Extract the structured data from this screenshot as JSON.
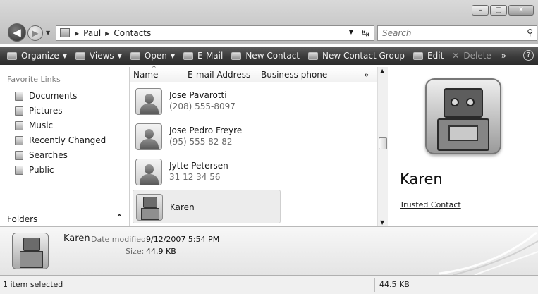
{
  "window": {
    "minimize_glyph": "–",
    "maximize_glyph": "▢",
    "close_glyph": "✕"
  },
  "address": {
    "crumbs": [
      "Paul",
      "Contacts"
    ]
  },
  "search": {
    "placeholder": "Search"
  },
  "toolbar": {
    "organize": "Organize",
    "views": "Views",
    "open": "Open",
    "email": "E-Mail",
    "new_contact": "New Contact",
    "new_contact_group": "New Contact Group",
    "edit": "Edit",
    "delete": "Delete",
    "more": "»",
    "help": "?"
  },
  "nav": {
    "favorites_title": "Favorite Links",
    "links": [
      "Documents",
      "Pictures",
      "Music",
      "Recently Changed",
      "Searches",
      "Public"
    ],
    "folders_label": "Folders"
  },
  "columns": {
    "name": "Name",
    "email": "E-mail Address",
    "phone": "Business phone",
    "more": "»"
  },
  "contacts": [
    {
      "name": "Jose Pavarotti",
      "phone": "(208) 555-8097"
    },
    {
      "name": "Jose Pedro Freyre",
      "phone": "(95) 555 82 82"
    },
    {
      "name": "Jytte Petersen",
      "phone": "31 12 34 56"
    },
    {
      "name": "Karen",
      "phone": ""
    }
  ],
  "preview": {
    "name": "Karen",
    "link": "Trusted Contact"
  },
  "details": {
    "name": "Karen",
    "date_label": "Date modified:",
    "date_value": "9/12/2007 5:54 PM",
    "size_label": "Size:",
    "size_value": "44.9 KB"
  },
  "status": {
    "left": "1 item selected",
    "right": "44.5 KB"
  }
}
